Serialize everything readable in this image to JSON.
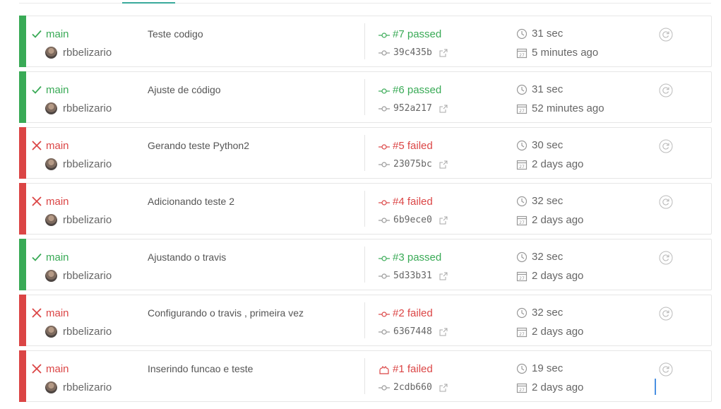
{
  "colors": {
    "passed": "#39aa56",
    "failed": "#db4545",
    "tab_accent": "#39aa9c"
  },
  "builds": [
    {
      "state": "passed",
      "branch": "main",
      "author": "rbbelizario",
      "message": "Teste codigo",
      "build": "#7 passed",
      "commit": "39c435b",
      "duration": "31 sec",
      "finished": "5 minutes ago"
    },
    {
      "state": "passed",
      "branch": "main",
      "author": "rbbelizario",
      "message": "Ajuste de código",
      "build": "#6 passed",
      "commit": "952a217",
      "duration": "31 sec",
      "finished": "52 minutes ago"
    },
    {
      "state": "failed",
      "branch": "main",
      "author": "rbbelizario",
      "message": "Gerando teste Python2",
      "build": "#5 failed",
      "commit": "23075bc",
      "duration": "30 sec",
      "finished": "2 days ago"
    },
    {
      "state": "failed",
      "branch": "main",
      "author": "rbbelizario",
      "message": "Adicionando teste 2",
      "build": "#4 failed",
      "commit": "6b9ece0",
      "duration": "32 sec",
      "finished": "2 days ago"
    },
    {
      "state": "passed",
      "branch": "main",
      "author": "rbbelizario",
      "message": "Ajustando o travis",
      "build": "#3 passed",
      "commit": "5d33b31",
      "duration": "32 sec",
      "finished": "2 days ago"
    },
    {
      "state": "failed",
      "branch": "main",
      "author": "rbbelizario",
      "message": "Configurando o travis , primeira vez",
      "build": "#2 failed",
      "commit": "6367448",
      "duration": "32 sec",
      "finished": "2 days ago"
    },
    {
      "state": "failed",
      "branch": "main",
      "author": "rbbelizario",
      "message": "Inserindo funcao e teste",
      "build": "#1 failed",
      "commit": "2cdb660",
      "duration": "19 sec",
      "finished": "2 days ago",
      "build_icon": "bell-icon"
    }
  ]
}
